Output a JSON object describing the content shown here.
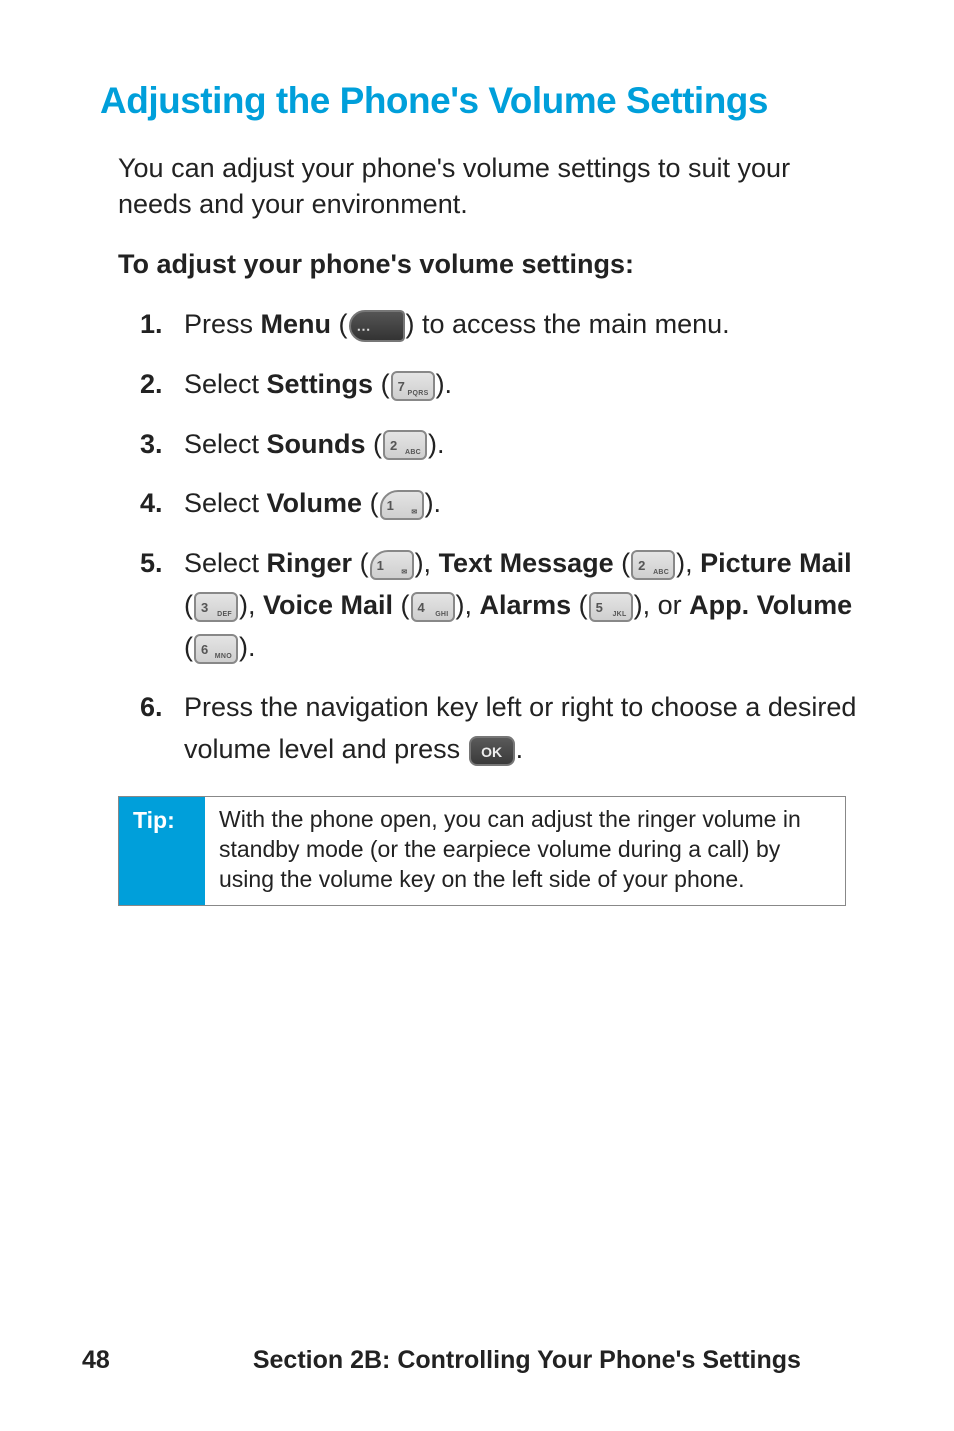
{
  "heading": "Adjusting the Phone's Volume Settings",
  "intro": "You can adjust your phone's volume settings to suit your needs and your environment.",
  "subhead": "To adjust your phone's volume settings:",
  "steps": {
    "s1": {
      "num": "1.",
      "pre": "Press ",
      "action": "Menu",
      "post": " (",
      "post2": ") to access the main menu."
    },
    "s2": {
      "num": "2.",
      "pre": "Select ",
      "action": "Settings",
      "post": " (",
      "post2": ")."
    },
    "s3": {
      "num": "3.",
      "pre": "Select ",
      "action": "Sounds",
      "post": " (",
      "post2": ")."
    },
    "s4": {
      "num": "4.",
      "pre": "Select ",
      "action": "Volume",
      "post": " (",
      "post2": ")."
    },
    "s5": {
      "num": "5.",
      "pre": "Select ",
      "a1": "Ringer",
      "mid1": " (",
      "mid1b": "), ",
      "a2": "Text Message",
      "mid2": " (",
      "mid2b": "), ",
      "a3": "Picture Mail",
      "mid3": " (",
      "mid3b": "), ",
      "a4": "Voice Mail",
      "mid4": " (",
      "mid4b": "), ",
      "a5": "Alarms",
      "mid5": " (",
      "mid5b": "), or ",
      "a6": "App. Volume",
      "mid6": " (",
      "mid6b": ")."
    },
    "s6": {
      "num": "6.",
      "text1": "Press the navigation key left or right to choose a desired volume level and press ",
      "text2": "."
    }
  },
  "keys": {
    "k7": {
      "big": "7",
      "sub": "PQRS"
    },
    "k2": {
      "big": "2",
      "sub": "ABC"
    },
    "k1": {
      "big": "1",
      "sub": "✉"
    },
    "k3": {
      "big": "3",
      "sub": "DEF"
    },
    "k4": {
      "big": "4",
      "sub": "GHI"
    },
    "k5": {
      "big": "5",
      "sub": "JKL"
    },
    "k6": {
      "big": "6",
      "sub": "MNO"
    },
    "ok": "OK"
  },
  "tip": {
    "label": "Tip:",
    "text": "With the phone open, you can adjust the ringer volume in standby mode (or the earpiece volume during a call) by using the volume key on the left side of your phone."
  },
  "footer": {
    "page": "48",
    "section": "Section 2B: Controlling Your Phone's Settings"
  }
}
